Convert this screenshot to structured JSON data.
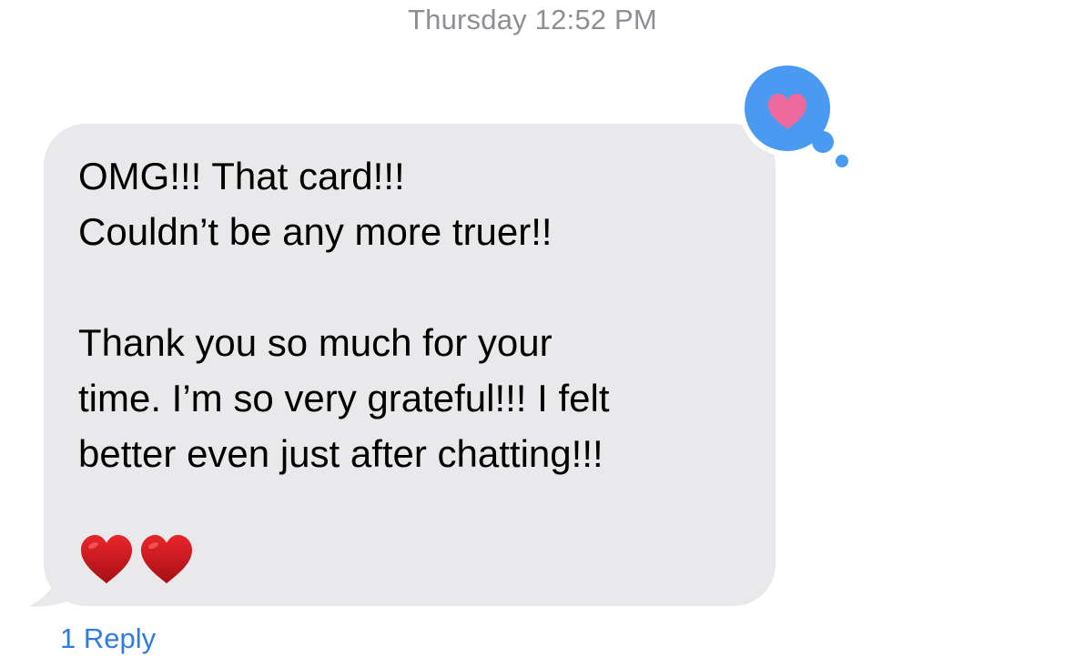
{
  "timestamp": {
    "day": "Thursday",
    "time": "12:52 PM"
  },
  "message": {
    "text": "OMG!!! That card!!!\nCouldn’t be any more truer!!\n\nThank you so much for your\ntime. I’m so very grateful!!! I felt\nbetter even just after chatting!!!",
    "emoji": [
      "red-heart",
      "red-heart"
    ],
    "bubble_color": "#e9e9eb"
  },
  "tapback": {
    "icon": "heart-icon",
    "bubble_color": "#4a9af2",
    "heart_color": "#ef6a9c"
  },
  "reply": {
    "label": "1 Reply",
    "color": "#2f7ce0"
  }
}
